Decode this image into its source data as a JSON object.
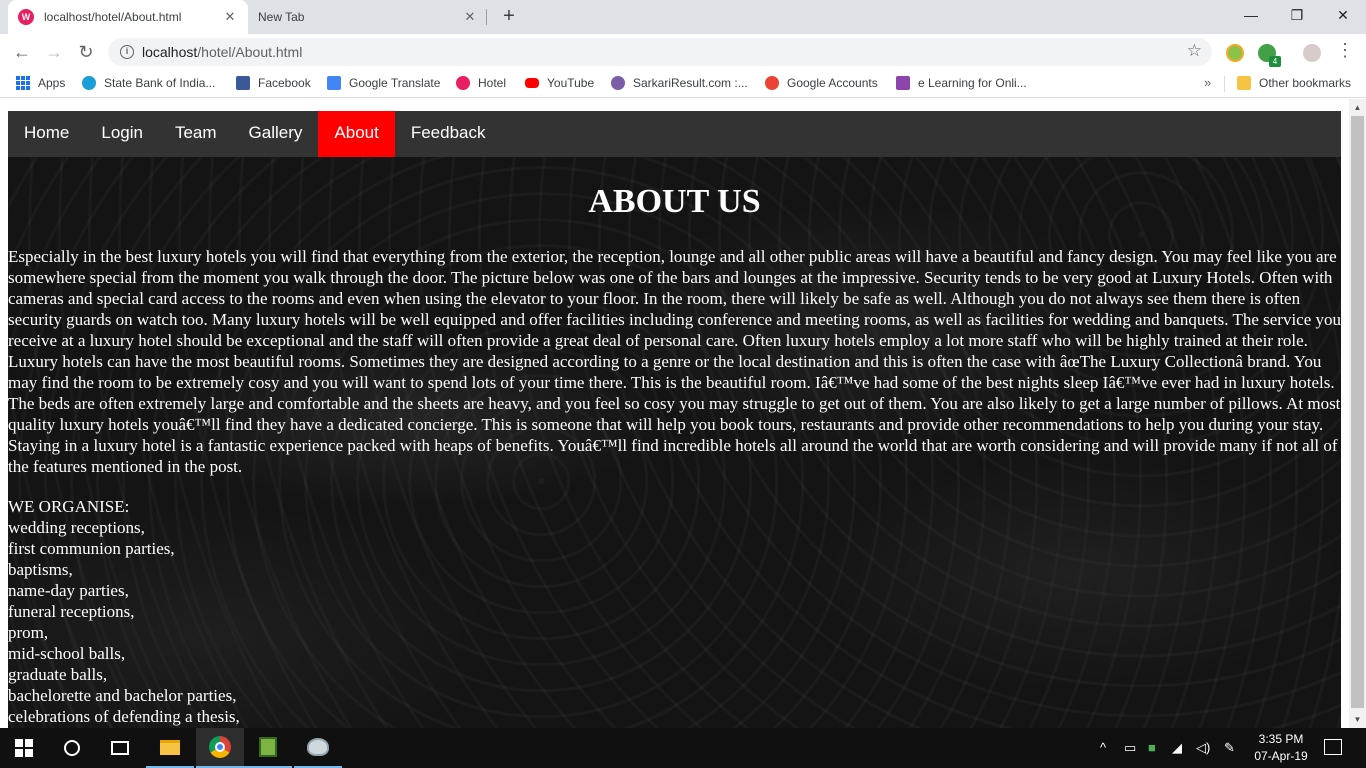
{
  "browser": {
    "tabs": [
      {
        "title": "localhost/hotel/About.html",
        "active": true
      },
      {
        "title": "New Tab",
        "active": false
      }
    ],
    "new_tab_symbol": "+",
    "window_controls": {
      "minimize": "—",
      "restore": "❐",
      "close": "✕"
    },
    "url_host": "localhost",
    "url_path": "/hotel/About.html",
    "bookmarks": [
      {
        "label": "Apps",
        "icon": "apps-grid-icon"
      },
      {
        "label": "State Bank of India...",
        "icon": "sbi-icon",
        "color": "#1a9ed8"
      },
      {
        "label": "Facebook",
        "icon": "facebook-icon",
        "color": "#3b5998"
      },
      {
        "label": "Google Translate",
        "icon": "google-translate-icon",
        "color": "#4285f4"
      },
      {
        "label": "Hotel",
        "icon": "hotel-icon",
        "color": "#e91e63"
      },
      {
        "label": "YouTube",
        "icon": "youtube-icon",
        "color": "#ff0000"
      },
      {
        "label": "SarkariResult.com :...",
        "icon": "sarkari-icon",
        "color": "#7b5ea7"
      },
      {
        "label": "Google Accounts",
        "icon": "google-icon",
        "color": "#ea4335"
      },
      {
        "label": "e Learning for Onli...",
        "icon": "elearning-icon",
        "color": "#8e44ad"
      }
    ],
    "bookmarks_overflow": "»",
    "other_bookmarks": "Other bookmarks",
    "extension_badge": "4"
  },
  "site": {
    "nav": [
      {
        "label": "Home",
        "active": false
      },
      {
        "label": "Login",
        "active": false
      },
      {
        "label": "Team",
        "active": false
      },
      {
        "label": "Gallery",
        "active": false
      },
      {
        "label": "About",
        "active": true
      },
      {
        "label": "Feedback",
        "active": false
      }
    ],
    "nav_active_color": "#ff0000",
    "heading": "ABOUT US",
    "paragraph": "Especially in the best luxury hotels you will find that everything from the exterior, the reception, lounge and all other public areas will have a beautiful and fancy design. You may feel like you are somewhere special from the moment you walk through the door. The picture below was one of the bars and lounges at the impressive. Security tends to be very good at Luxury Hotels. Often with cameras and special card access to the rooms and even when using the elevator to your floor. In the room, there will likely be safe as well. Although you do not always see them there is often security guards on watch too. Many luxury hotels will be well equipped and offer facilities including conference and meeting rooms, as well as facilities for wedding and banquets. The service you receive at a luxury hotel should be exceptional and the staff will often provide a great deal of personal care. Often luxury hotels employ a lot more staff who will be highly trained at their role. Luxury hotels can have the most beautiful rooms. Sometimes they are designed according to a genre or the local destination and this is often the case with âœThe Luxury Collectionâ brand. You may find the room to be extremely cosy and you will want to spend lots of your time there. This is the beautiful room. Iâ€™ve had some of the best nights sleep Iâ€™ve ever had in luxury hotels. The beds are often extremely large and comfortable and the sheets are heavy, and you feel so cosy you may struggle to get out of them. You are also likely to get a large number of pillows. At most quality luxury hotels youâ€™ll find they have a dedicated concierge. This is someone that will help you book tours, restaurants and provide other recommendations to help you during your stay. Staying in a luxury hotel is a fantastic experience packed with heaps of benefits. Youâ€™ll find incredible hotels all around the world that are worth considering and will provide many if not all of the features mentioned in the post.",
    "organise_heading": "WE ORGANISE:",
    "organise_items": [
      "wedding receptions,",
      "first communion parties,",
      "baptisms,",
      "name-day parties,",
      "funeral receptions,",
      "prom,",
      "mid-school balls,",
      "graduate balls,",
      "bachelorette and bachelor parties,",
      "celebrations of defending a thesis,"
    ]
  },
  "taskbar": {
    "time": "3:35 PM",
    "date": "07-Apr-19",
    "tray_icons": [
      "chevron-up-icon",
      "battery-icon",
      "app-tray-icon",
      "network-icon",
      "volume-icon",
      "pen-icon"
    ]
  }
}
